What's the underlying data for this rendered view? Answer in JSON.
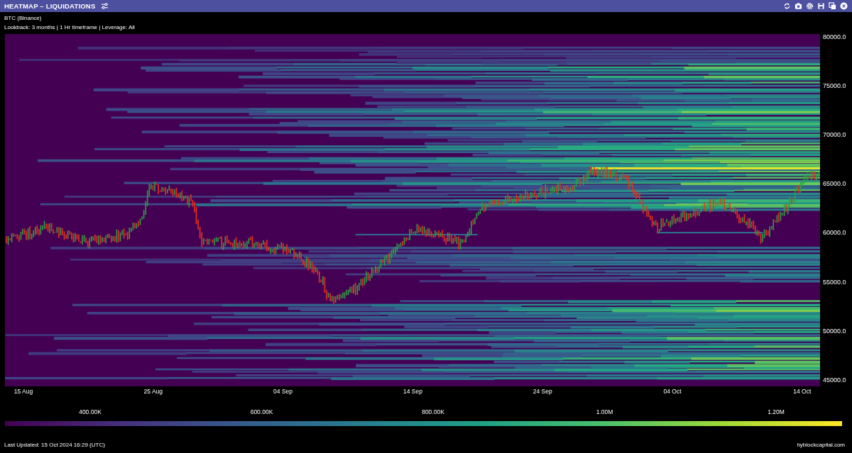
{
  "header": {
    "title": "HEATMAP – LIQUIDATIONS"
  },
  "subtitle": "BTC (Binance)",
  "details": "Lookback: 3 months | 1 Hr timeframe | Leverage: All",
  "chart": {
    "y_labels": [
      "80000.0",
      "75000.0",
      "70000.0",
      "65000.0",
      "60000.0",
      "55000.0",
      "50000.0",
      "45000.0"
    ],
    "x_labels": [
      "15 Aug",
      "25 Aug",
      "04 Sep",
      "14 Sep",
      "24 Sep",
      "04 Oct",
      "14 Oct"
    ]
  },
  "colorbar": {
    "labels": [
      "400.00K",
      "600.00K",
      "800.00K",
      "1.00M",
      "1.20M"
    ]
  },
  "footer": {
    "updated": "Last Updated: 15 Oct 2024 16:29 (UTC)",
    "site": "hyblockcapital.com"
  }
}
